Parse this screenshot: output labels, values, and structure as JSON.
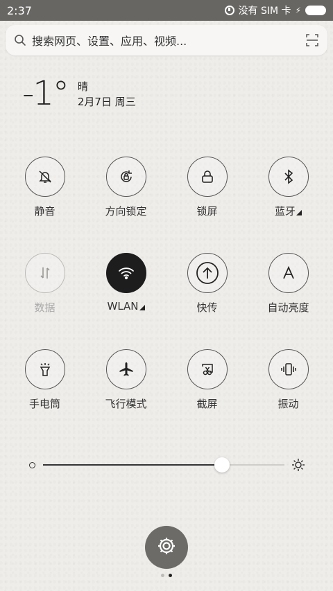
{
  "status_bar": {
    "time": "2:37",
    "sim_text": "没有 SIM 卡"
  },
  "search": {
    "placeholder": "搜索网页、设置、应用、视频..."
  },
  "weather": {
    "temperature": "-1°",
    "condition": "晴",
    "date": "2月7日 周三"
  },
  "toggles": [
    [
      {
        "label": "静音",
        "icon": "bell-off-icon",
        "state": "off"
      },
      {
        "label": "方向锁定",
        "icon": "rotation-lock-icon",
        "state": "off"
      },
      {
        "label": "锁屏",
        "icon": "lock-icon",
        "state": "off"
      },
      {
        "label": "蓝牙",
        "icon": "bluetooth-icon",
        "state": "off",
        "has_more": true
      }
    ],
    [
      {
        "label": "数据",
        "icon": "data-arrows-icon",
        "state": "disabled"
      },
      {
        "label": "WLAN",
        "icon": "wifi-icon",
        "state": "on",
        "has_more": true
      },
      {
        "label": "快传",
        "icon": "upload-arrow-icon",
        "state": "off"
      },
      {
        "label": "自动亮度",
        "icon": "auto-brightness-icon",
        "state": "off"
      }
    ],
    [
      {
        "label": "手电筒",
        "icon": "flashlight-icon",
        "state": "off"
      },
      {
        "label": "飞行模式",
        "icon": "airplane-icon",
        "state": "off"
      },
      {
        "label": "截屏",
        "icon": "screenshot-icon",
        "state": "off"
      },
      {
        "label": "振动",
        "icon": "vibrate-icon",
        "state": "off"
      }
    ]
  ],
  "brightness": {
    "level": 0.74
  },
  "pager": {
    "pages": 2,
    "current": 2
  },
  "colors": {
    "status_bar": "#686663",
    "active_toggle": "#1d1d1d",
    "fab": "#6d6b68"
  }
}
